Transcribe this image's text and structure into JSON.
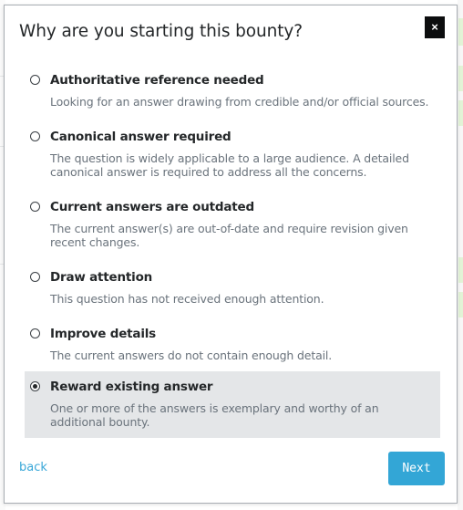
{
  "dialog": {
    "title": "Why are you starting this bounty?",
    "close_label": "×",
    "options": [
      {
        "label": "Authoritative reference needed",
        "description": "Looking for an answer drawing from credible and/or official sources.",
        "selected": false
      },
      {
        "label": "Canonical answer required",
        "description": "The question is widely applicable to a large audience. A detailed canonical answer is required to address all the concerns.",
        "selected": false
      },
      {
        "label": "Current answers are outdated",
        "description": "The current answer(s) are out-of-date and require revision given recent changes.",
        "selected": false
      },
      {
        "label": "Draw attention",
        "description": "This question has not received enough attention.",
        "selected": false
      },
      {
        "label": "Improve details",
        "description": "The current answers do not contain enough detail.",
        "selected": false
      },
      {
        "label": "Reward existing answer",
        "description": "One or more of the answers is exemplary and worthy of an additional bounty.",
        "selected": true
      }
    ],
    "back_label": "back",
    "next_label": "Next"
  },
  "colors": {
    "accent": "#33a6d6",
    "link": "#39a7d8",
    "selected_bg": "#e4e6e8",
    "close_bg": "#0c0d0e"
  }
}
